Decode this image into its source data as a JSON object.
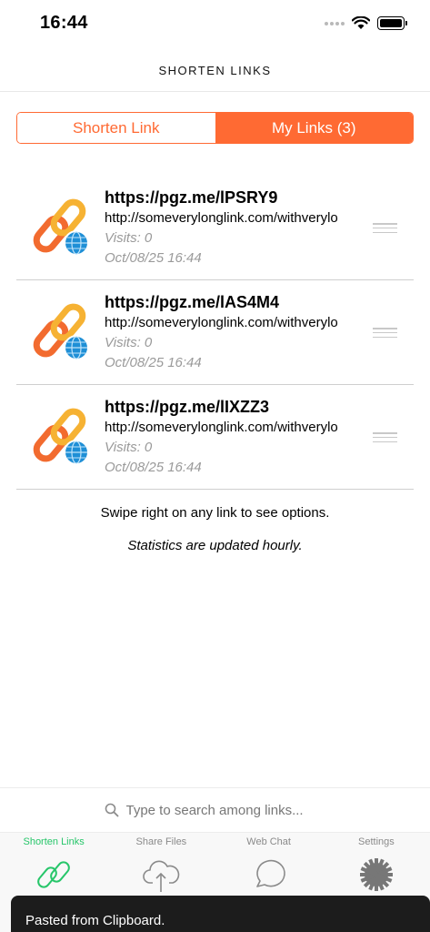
{
  "status_bar": {
    "time": "16:44"
  },
  "nav": {
    "title": "SHORTEN LINKS"
  },
  "segments": {
    "shorten_label": "Shorten Link",
    "my_links_label": "My Links (3)"
  },
  "links": [
    {
      "short_url": "https://pgz.me/lPSRY9",
      "long_url": "http://someverylonglink.com/withverylo",
      "visits": "Visits: 0",
      "date": "Oct/08/25 16:44"
    },
    {
      "short_url": "https://pgz.me/lAS4M4",
      "long_url": "http://someverylonglink.com/withverylo",
      "visits": "Visits: 0",
      "date": "Oct/08/25 16:44"
    },
    {
      "short_url": "https://pgz.me/lIXZZ3",
      "long_url": "http://someverylonglink.com/withverylo",
      "visits": "Visits: 0",
      "date": "Oct/08/25 16:44"
    }
  ],
  "hint": "Swipe right on any link to see options.",
  "stats_note": "Statistics are updated hourly.",
  "search": {
    "placeholder": "Type to search among links..."
  },
  "tabs": [
    {
      "label": "Shorten Links",
      "icon": "link-icon",
      "active": true
    },
    {
      "label": "Share Files",
      "icon": "cloud-upload-icon",
      "active": false
    },
    {
      "label": "Web Chat",
      "icon": "chat-bubble-icon",
      "active": false
    },
    {
      "label": "Settings",
      "icon": "gear-icon",
      "active": false
    }
  ],
  "toast": {
    "text": "Pasted from Clipboard."
  },
  "colors": {
    "accent": "#ff6a33",
    "active_tab": "#27c66a",
    "chain_orange": "#f26b2f",
    "chain_yellow": "#f6b233",
    "globe_blue": "#1f8fd6"
  }
}
